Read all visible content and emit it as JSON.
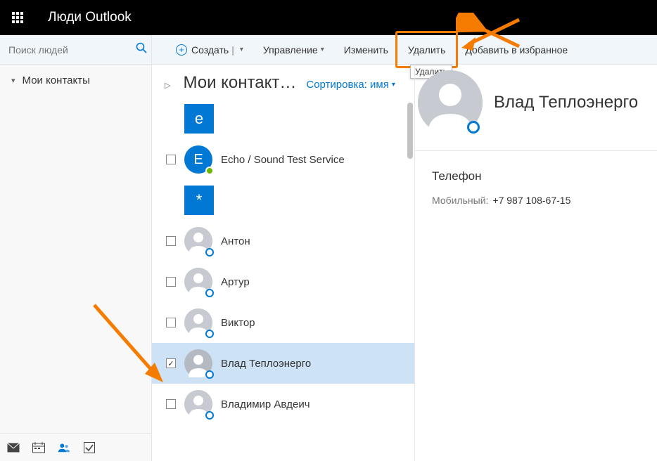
{
  "header": {
    "app_title": "Люди Outlook"
  },
  "search": {
    "placeholder": "Поиск людей"
  },
  "toolbar": {
    "create": "Создать",
    "manage": "Управление",
    "edit": "Изменить",
    "delete": "Удалить",
    "favorite": "Добавить в избранное"
  },
  "tooltip": {
    "delete": "Удалить"
  },
  "sidebar": {
    "my_contacts": "Мои контакты"
  },
  "mid": {
    "title": "Мои контакт…",
    "sort_prefix": "Сортировка:",
    "sort_value": "имя"
  },
  "tiles": {
    "e": "e",
    "star": "*"
  },
  "contacts": [
    {
      "name": "Echo / Sound Test Service",
      "avatar_letter": "E",
      "presence": "available",
      "checked": false
    },
    {
      "name": "Антон",
      "presence": "offline",
      "checked": false
    },
    {
      "name": "Артур",
      "presence": "offline",
      "checked": false
    },
    {
      "name": "Виктор",
      "presence": "offline",
      "checked": false
    },
    {
      "name": "Влад Теплоэнерго",
      "presence": "offline",
      "checked": true,
      "selected": true
    },
    {
      "name": "Владимир Авдеич",
      "presence": "offline",
      "checked": false
    }
  ],
  "detail": {
    "name": "Влад Теплоэнерго",
    "phone_section": "Телефон",
    "mobile_label": "Мобильный:",
    "mobile_value": "+7 987 108-67-15"
  }
}
